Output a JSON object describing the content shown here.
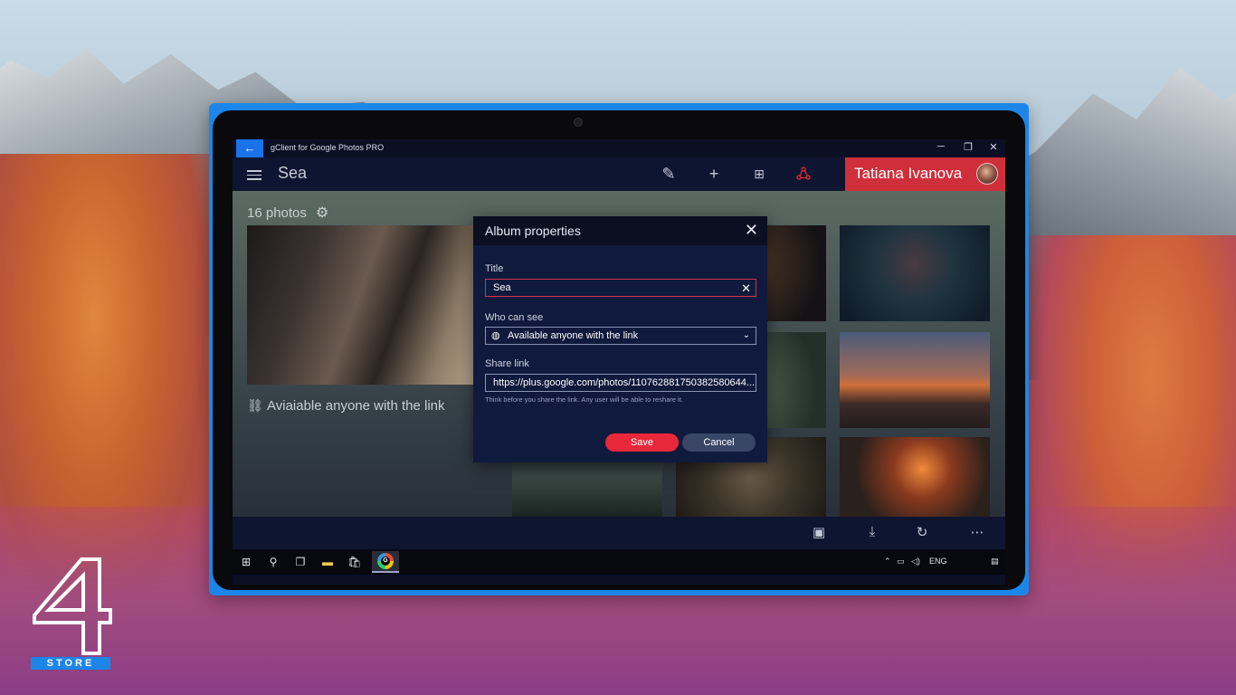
{
  "window": {
    "app_title": "gClient for Google Photos PRO",
    "back_icon": "arrow-left-icon",
    "minimize_glyph": "─",
    "restore_glyph": "❐",
    "close_glyph": "✕"
  },
  "appbar": {
    "album_title": "Sea",
    "tools": [
      "edit-icon",
      "add-icon",
      "grid-icon",
      "share-icon"
    ],
    "user_name": "Tatiana Ivanova"
  },
  "album": {
    "photo_count": "16 photos",
    "visibility_text": "Aviaiable anyone with the link"
  },
  "dialog": {
    "title": "Album properties",
    "title_label": "Title",
    "title_value": "Sea",
    "who_label": "Who can see",
    "who_value": "Available anyone with the link",
    "share_label": "Share link",
    "share_value": "https://plus.google.com/photos/110762881750382580644...",
    "hint": "Think before you share the link. Any user will be able to reshare it.",
    "save_label": "Save",
    "cancel_label": "Cancel"
  },
  "bottom_bar": {
    "icons": [
      "slideshow-icon",
      "download-icon",
      "refresh-icon",
      "more-icon"
    ]
  },
  "taskbar": {
    "language": "ENG"
  },
  "colors": {
    "accent_red": "#cf2f3a",
    "save_red": "#e8283a",
    "frame_blue": "#1b86e8",
    "dialog_bg": "#0f1a3c"
  },
  "logo": {
    "mark": "4",
    "strip_text": "STORE"
  }
}
